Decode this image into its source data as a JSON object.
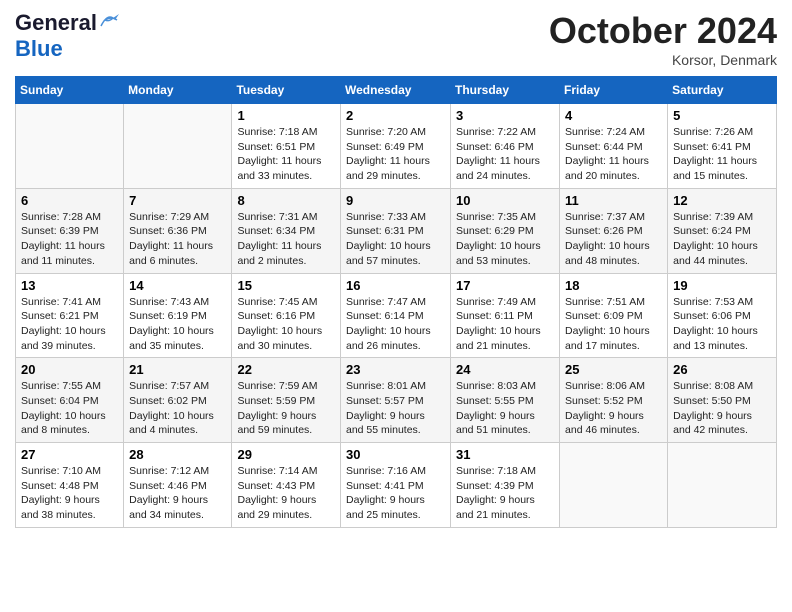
{
  "header": {
    "logo_line1": "General",
    "logo_line2": "Blue",
    "month": "October 2024",
    "location": "Korsor, Denmark"
  },
  "weekdays": [
    "Sunday",
    "Monday",
    "Tuesday",
    "Wednesday",
    "Thursday",
    "Friday",
    "Saturday"
  ],
  "weeks": [
    [
      {
        "day": "",
        "info": ""
      },
      {
        "day": "",
        "info": ""
      },
      {
        "day": "1",
        "info": "Sunrise: 7:18 AM\nSunset: 6:51 PM\nDaylight: 11 hours\nand 33 minutes."
      },
      {
        "day": "2",
        "info": "Sunrise: 7:20 AM\nSunset: 6:49 PM\nDaylight: 11 hours\nand 29 minutes."
      },
      {
        "day": "3",
        "info": "Sunrise: 7:22 AM\nSunset: 6:46 PM\nDaylight: 11 hours\nand 24 minutes."
      },
      {
        "day": "4",
        "info": "Sunrise: 7:24 AM\nSunset: 6:44 PM\nDaylight: 11 hours\nand 20 minutes."
      },
      {
        "day": "5",
        "info": "Sunrise: 7:26 AM\nSunset: 6:41 PM\nDaylight: 11 hours\nand 15 minutes."
      }
    ],
    [
      {
        "day": "6",
        "info": "Sunrise: 7:28 AM\nSunset: 6:39 PM\nDaylight: 11 hours\nand 11 minutes."
      },
      {
        "day": "7",
        "info": "Sunrise: 7:29 AM\nSunset: 6:36 PM\nDaylight: 11 hours\nand 6 minutes."
      },
      {
        "day": "8",
        "info": "Sunrise: 7:31 AM\nSunset: 6:34 PM\nDaylight: 11 hours\nand 2 minutes."
      },
      {
        "day": "9",
        "info": "Sunrise: 7:33 AM\nSunset: 6:31 PM\nDaylight: 10 hours\nand 57 minutes."
      },
      {
        "day": "10",
        "info": "Sunrise: 7:35 AM\nSunset: 6:29 PM\nDaylight: 10 hours\nand 53 minutes."
      },
      {
        "day": "11",
        "info": "Sunrise: 7:37 AM\nSunset: 6:26 PM\nDaylight: 10 hours\nand 48 minutes."
      },
      {
        "day": "12",
        "info": "Sunrise: 7:39 AM\nSunset: 6:24 PM\nDaylight: 10 hours\nand 44 minutes."
      }
    ],
    [
      {
        "day": "13",
        "info": "Sunrise: 7:41 AM\nSunset: 6:21 PM\nDaylight: 10 hours\nand 39 minutes."
      },
      {
        "day": "14",
        "info": "Sunrise: 7:43 AM\nSunset: 6:19 PM\nDaylight: 10 hours\nand 35 minutes."
      },
      {
        "day": "15",
        "info": "Sunrise: 7:45 AM\nSunset: 6:16 PM\nDaylight: 10 hours\nand 30 minutes."
      },
      {
        "day": "16",
        "info": "Sunrise: 7:47 AM\nSunset: 6:14 PM\nDaylight: 10 hours\nand 26 minutes."
      },
      {
        "day": "17",
        "info": "Sunrise: 7:49 AM\nSunset: 6:11 PM\nDaylight: 10 hours\nand 21 minutes."
      },
      {
        "day": "18",
        "info": "Sunrise: 7:51 AM\nSunset: 6:09 PM\nDaylight: 10 hours\nand 17 minutes."
      },
      {
        "day": "19",
        "info": "Sunrise: 7:53 AM\nSunset: 6:06 PM\nDaylight: 10 hours\nand 13 minutes."
      }
    ],
    [
      {
        "day": "20",
        "info": "Sunrise: 7:55 AM\nSunset: 6:04 PM\nDaylight: 10 hours\nand 8 minutes."
      },
      {
        "day": "21",
        "info": "Sunrise: 7:57 AM\nSunset: 6:02 PM\nDaylight: 10 hours\nand 4 minutes."
      },
      {
        "day": "22",
        "info": "Sunrise: 7:59 AM\nSunset: 5:59 PM\nDaylight: 9 hours\nand 59 minutes."
      },
      {
        "day": "23",
        "info": "Sunrise: 8:01 AM\nSunset: 5:57 PM\nDaylight: 9 hours\nand 55 minutes."
      },
      {
        "day": "24",
        "info": "Sunrise: 8:03 AM\nSunset: 5:55 PM\nDaylight: 9 hours\nand 51 minutes."
      },
      {
        "day": "25",
        "info": "Sunrise: 8:06 AM\nSunset: 5:52 PM\nDaylight: 9 hours\nand 46 minutes."
      },
      {
        "day": "26",
        "info": "Sunrise: 8:08 AM\nSunset: 5:50 PM\nDaylight: 9 hours\nand 42 minutes."
      }
    ],
    [
      {
        "day": "27",
        "info": "Sunrise: 7:10 AM\nSunset: 4:48 PM\nDaylight: 9 hours\nand 38 minutes."
      },
      {
        "day": "28",
        "info": "Sunrise: 7:12 AM\nSunset: 4:46 PM\nDaylight: 9 hours\nand 34 minutes."
      },
      {
        "day": "29",
        "info": "Sunrise: 7:14 AM\nSunset: 4:43 PM\nDaylight: 9 hours\nand 29 minutes."
      },
      {
        "day": "30",
        "info": "Sunrise: 7:16 AM\nSunset: 4:41 PM\nDaylight: 9 hours\nand 25 minutes."
      },
      {
        "day": "31",
        "info": "Sunrise: 7:18 AM\nSunset: 4:39 PM\nDaylight: 9 hours\nand 21 minutes."
      },
      {
        "day": "",
        "info": ""
      },
      {
        "day": "",
        "info": ""
      }
    ]
  ]
}
